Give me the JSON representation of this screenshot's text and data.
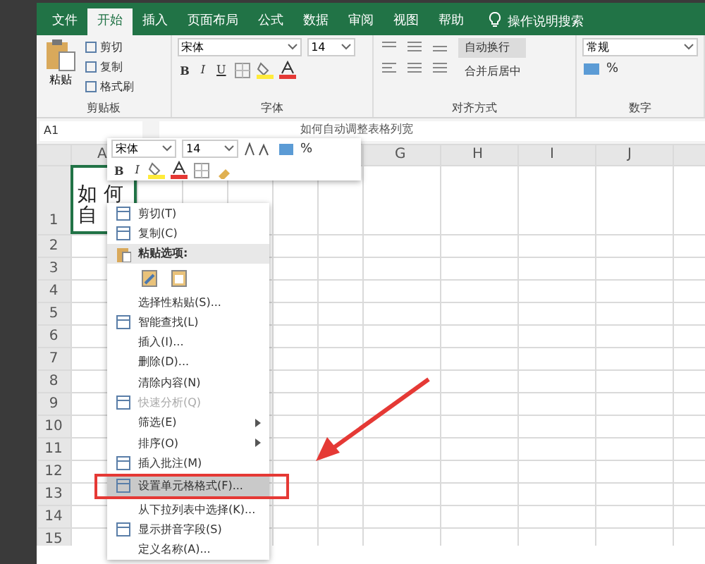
{
  "ribbon": {
    "tabs": [
      {
        "label": "文件",
        "selected": false
      },
      {
        "label": "开始",
        "selected": true
      },
      {
        "label": "插入",
        "selected": false
      },
      {
        "label": "页面布局",
        "selected": false
      },
      {
        "label": "公式",
        "selected": false
      },
      {
        "label": "数据",
        "selected": false
      },
      {
        "label": "审阅",
        "selected": false
      },
      {
        "label": "视图",
        "selected": false
      },
      {
        "label": "帮助",
        "selected": false
      }
    ],
    "search": {
      "placeholder": "操作说明搜索"
    },
    "clipboard": {
      "title": "剪贴板",
      "paste": "粘贴",
      "items": [
        "剪切",
        "复制",
        "格式刷"
      ]
    },
    "font": {
      "title": "字体",
      "font_name": "宋体",
      "font_size": "14",
      "buttons": [
        "B",
        "I",
        "U"
      ]
    },
    "alignment": {
      "title": "对齐方式",
      "wrap": "自动换行",
      "merge": "合并后居中"
    },
    "number": {
      "title": "数字",
      "format": "常规",
      "symbols": [
        "%"
      ]
    }
  },
  "formula_bar": {
    "name_box": "A1",
    "value": "如何自动调整表格列宽"
  },
  "mini_toolbar": {
    "font_name": "宋体",
    "font_size": "14",
    "symbols": [
      "%"
    ],
    "buttons": [
      "B",
      "I"
    ]
  },
  "sheet": {
    "columns": [
      "A",
      "G",
      "H",
      "I",
      "J"
    ],
    "rows": [
      "1",
      "2",
      "3",
      "4",
      "5",
      "6",
      "7",
      "8",
      "9",
      "10",
      "11",
      "12",
      "13",
      "14",
      "15"
    ],
    "cell_a1": [
      "如 何",
      "自"
    ]
  },
  "context_menu": {
    "items": [
      {
        "kind": "item",
        "label": "剪切(T)",
        "disabled": false,
        "selected": false,
        "submenu": false
      },
      {
        "kind": "item",
        "label": "复制(C)",
        "disabled": false,
        "selected": false,
        "submenu": false
      },
      {
        "kind": "header",
        "label": "粘贴选项:"
      },
      {
        "kind": "paste_icons"
      },
      {
        "kind": "item",
        "label": "选择性粘贴(S)...",
        "disabled": false,
        "selected": false,
        "submenu": false
      },
      {
        "kind": "item",
        "label": "智能查找(L)",
        "disabled": false,
        "selected": false,
        "submenu": false
      },
      {
        "kind": "item",
        "label": "插入(I)...",
        "disabled": false,
        "selected": false,
        "submenu": false
      },
      {
        "kind": "item",
        "label": "删除(D)...",
        "disabled": false,
        "selected": false,
        "submenu": false
      },
      {
        "kind": "item",
        "label": "清除内容(N)",
        "disabled": false,
        "selected": false,
        "submenu": false
      },
      {
        "kind": "item",
        "label": "快速分析(Q)",
        "disabled": true,
        "selected": false,
        "submenu": false
      },
      {
        "kind": "item",
        "label": "筛选(E)",
        "disabled": false,
        "selected": false,
        "submenu": true
      },
      {
        "kind": "item",
        "label": "排序(O)",
        "disabled": false,
        "selected": false,
        "submenu": true
      },
      {
        "kind": "item",
        "label": "插入批注(M)",
        "disabled": false,
        "selected": false,
        "submenu": false
      },
      {
        "kind": "item",
        "label": "设置单元格格式(F)...",
        "disabled": false,
        "selected": true,
        "submenu": false
      },
      {
        "kind": "item",
        "label": "从下拉列表中选择(K)...",
        "disabled": false,
        "selected": false,
        "submenu": false
      },
      {
        "kind": "item",
        "label": "显示拼音字段(S)",
        "disabled": false,
        "selected": false,
        "submenu": false
      },
      {
        "kind": "item",
        "label": "定义名称(A)...",
        "disabled": false,
        "selected": false,
        "submenu": false
      }
    ]
  }
}
